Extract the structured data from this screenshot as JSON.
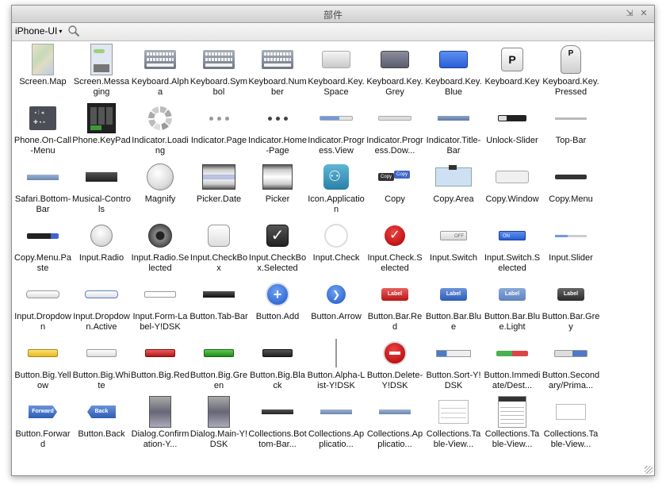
{
  "window": {
    "title": "部件",
    "collapse_icon": "⇲",
    "close_icon": "✕"
  },
  "toolbar": {
    "library": "iPhone-UI",
    "library_arrow": "▾"
  },
  "items": [
    {
      "label": "Screen.Map",
      "icon": "phone-map"
    },
    {
      "label": "Screen.Messaging",
      "icon": "phone-msg"
    },
    {
      "label": "Keyboard.Alpha",
      "icon": "kbd"
    },
    {
      "label": "Keyboard.Symbol",
      "icon": "kbd"
    },
    {
      "label": "Keyboard.Number",
      "icon": "kbd"
    },
    {
      "label": "Keyboard.Key.Space",
      "icon": "key-space"
    },
    {
      "label": "Keyboard.Key.Grey",
      "icon": "key-grey"
    },
    {
      "label": "Keyboard.Key.Blue",
      "icon": "key-blue"
    },
    {
      "label": "Keyboard.Key",
      "icon": "key-p",
      "text": "P"
    },
    {
      "label": "Keyboard.Key.Pressed",
      "icon": "key-pressed",
      "text": "P"
    },
    {
      "label": "Phone.On-Call-Menu",
      "icon": "oncall"
    },
    {
      "label": "Phone.KeyPad",
      "icon": "keypad"
    },
    {
      "label": "Indicator.Loading",
      "icon": "spinner"
    },
    {
      "label": "Indicator.Page",
      "icon": "dots"
    },
    {
      "label": "Indicator.Home-Page",
      "icon": "dots dark"
    },
    {
      "label": "Indicator.Progress.View",
      "icon": "progbar"
    },
    {
      "label": "Indicator.Progress.Dow...",
      "icon": "progbar2"
    },
    {
      "label": "Indicator.Title-Bar",
      "icon": "titlebar-thumb"
    },
    {
      "label": "Unlock-Slider",
      "icon": "unlock"
    },
    {
      "label": "Top-Bar",
      "icon": "topbar"
    },
    {
      "label": "Safari.Bottom-Bar",
      "icon": "safari-bar"
    },
    {
      "label": "Musical-Controls",
      "icon": "musical"
    },
    {
      "label": "Magnify",
      "icon": "magnify"
    },
    {
      "label": "Picker.Date",
      "icon": "picker-date"
    },
    {
      "label": "Picker",
      "icon": "picker"
    },
    {
      "label": "Icon.Application",
      "icon": "appicon"
    },
    {
      "label": "Copy",
      "icon": "copy"
    },
    {
      "label": "Copy.Area",
      "icon": "copyarea"
    },
    {
      "label": "Copy.Window",
      "icon": "copywin"
    },
    {
      "label": "Copy.Menu",
      "icon": "copymenu"
    },
    {
      "label": "Copy.Menu.Paste",
      "icon": "copymenupaste"
    },
    {
      "label": "Input.Radio",
      "icon": "radio"
    },
    {
      "label": "Input.Radio.Selected",
      "icon": "radio-sel"
    },
    {
      "label": "Input.CheckBox",
      "icon": "checkbox"
    },
    {
      "label": "Input.CheckBox.Selected",
      "icon": "checkbox-sel",
      "text": "✓"
    },
    {
      "label": "Input.Check",
      "icon": "check-circle"
    },
    {
      "label": "Input.Check.Selected",
      "icon": "check-sel",
      "text": "✓"
    },
    {
      "label": "Input.Switch",
      "icon": "switch-off",
      "text": "OFF"
    },
    {
      "label": "Input.Switch.Selected",
      "icon": "switch-on",
      "text": "ON"
    },
    {
      "label": "Input.Slider",
      "icon": "slider"
    },
    {
      "label": "Input.Dropdown",
      "icon": "dropdown"
    },
    {
      "label": "Input.Dropdown.Active",
      "icon": "dropdown-act"
    },
    {
      "label": "Input.Form-Label-Y!DSK",
      "icon": "formlabel"
    },
    {
      "label": "Button.Tab-Bar",
      "icon": "tabbar"
    },
    {
      "label": "Button.Add",
      "icon": "btn-add",
      "text": "+"
    },
    {
      "label": "Button.Arrow",
      "icon": "btn-arrow",
      "text": "❯"
    },
    {
      "label": "Button.Bar.Red",
      "icon": "barbtn red",
      "text": "Label"
    },
    {
      "label": "Button.Bar.Blue",
      "icon": "barbtn blue",
      "text": "Label"
    },
    {
      "label": "Button.Bar.Blue.Light",
      "icon": "barbtn lblue",
      "text": "Label"
    },
    {
      "label": "Button.Bar.Grey",
      "icon": "barbtn grey",
      "text": "Label"
    },
    {
      "label": "Button.Big.Yellow",
      "icon": "bigbtn yellow"
    },
    {
      "label": "Button.Big.White",
      "icon": "bigbtn white"
    },
    {
      "label": "Button.Big.Red",
      "icon": "bigbtn red"
    },
    {
      "label": "Button.Big.Green",
      "icon": "bigbtn green"
    },
    {
      "label": "Button.Big.Black",
      "icon": "bigbtn black"
    },
    {
      "label": "Button.Alpha-List-Y!DSK",
      "icon": "alpha-list"
    },
    {
      "label": "Button.Delete-Y!DSK",
      "icon": "btn-delete"
    },
    {
      "label": "Button.Sort-Y!DSK",
      "icon": "sortbtn"
    },
    {
      "label": "Button.Immediate/Dest...",
      "icon": "immbtn"
    },
    {
      "label": "Button.Secondary/Prima...",
      "icon": "secbtn"
    },
    {
      "label": "Button.Forward",
      "icon": "fwd",
      "text": "Forward"
    },
    {
      "label": "Button.Back",
      "icon": "back",
      "text": "Back"
    },
    {
      "label": "Dialog.Confirmation-Y...",
      "icon": "dialog"
    },
    {
      "label": "Dialog.Main-Y!DSK",
      "icon": "dialog"
    },
    {
      "label": "Collections.Bottom-Bar...",
      "icon": "coll-bar"
    },
    {
      "label": "Collections.Applicatio...",
      "icon": "coll-app"
    },
    {
      "label": "Collections.Applicatio...",
      "icon": "coll-app"
    },
    {
      "label": "Collections.Table-View...",
      "icon": "tableview"
    },
    {
      "label": "Collections.Table-View...",
      "icon": "tableview2"
    },
    {
      "label": "Collections.Table-View...",
      "icon": "tableview3"
    }
  ]
}
